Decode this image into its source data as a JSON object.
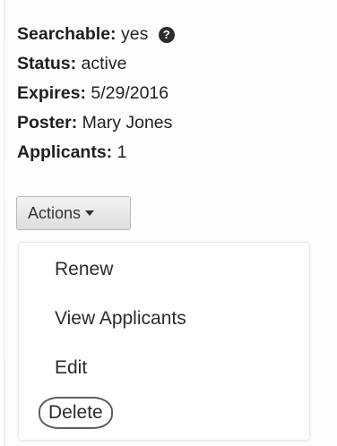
{
  "details": {
    "searchable": {
      "label": "Searchable:",
      "value": "yes",
      "help_icon": "question-circle-icon"
    },
    "status": {
      "label": "Status:",
      "value": "active"
    },
    "expires": {
      "label": "Expires:",
      "value": "5/29/2016"
    },
    "poster": {
      "label": "Poster:",
      "value": "Mary Jones"
    },
    "applicants": {
      "label": "Applicants:",
      "value": "1"
    }
  },
  "actions_button": {
    "label": "Actions",
    "icon": "caret-down-icon"
  },
  "menu": {
    "items": [
      {
        "label": "Renew"
      },
      {
        "label": "View Applicants"
      },
      {
        "label": "Edit"
      },
      {
        "label": "Delete"
      }
    ]
  }
}
